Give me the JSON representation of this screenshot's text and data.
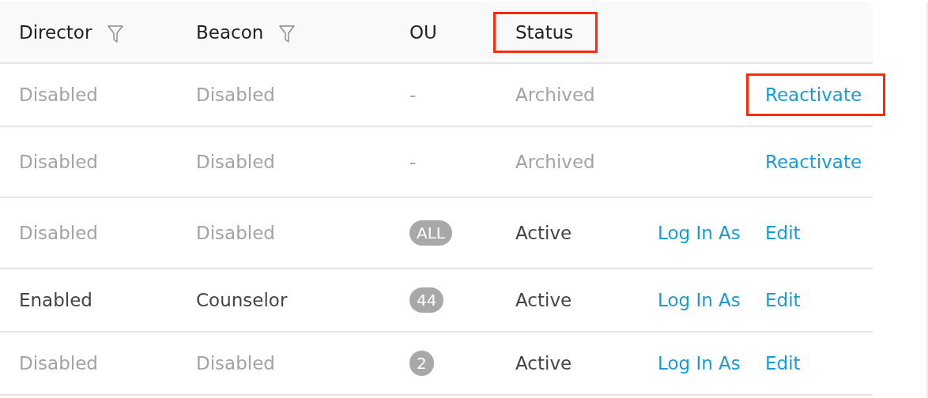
{
  "table": {
    "columns": [
      {
        "label": "Director",
        "filter": true,
        "highlighted": false
      },
      {
        "label": "Beacon",
        "filter": true,
        "highlighted": false
      },
      {
        "label": "OU",
        "filter": false,
        "highlighted": false
      },
      {
        "label": "Status",
        "filter": false,
        "highlighted": true
      }
    ],
    "rows": [
      {
        "director": {
          "text": "Disabled",
          "dimmed": true
        },
        "beacon": {
          "text": "Disabled",
          "dimmed": true
        },
        "ou": {
          "kind": "text",
          "text": "-"
        },
        "status": {
          "text": "Archived",
          "dimmed": true
        },
        "action_right": {
          "label": "Reactivate",
          "highlighted": true
        }
      },
      {
        "director": {
          "text": "Disabled",
          "dimmed": true
        },
        "beacon": {
          "text": "Disabled",
          "dimmed": true
        },
        "ou": {
          "kind": "text",
          "text": "-"
        },
        "status": {
          "text": "Archived",
          "dimmed": true
        },
        "action_right": {
          "label": "Reactivate",
          "highlighted": false
        }
      },
      {
        "director": {
          "text": "Disabled",
          "dimmed": true
        },
        "beacon": {
          "text": "Disabled",
          "dimmed": true
        },
        "ou": {
          "kind": "badge",
          "text": "ALL"
        },
        "status": {
          "text": "Active",
          "dimmed": false
        },
        "action_left": {
          "label": "Log In As",
          "highlighted": false
        },
        "action_right": {
          "label": "Edit",
          "highlighted": false
        }
      },
      {
        "director": {
          "text": "Enabled",
          "dimmed": false
        },
        "beacon": {
          "text": "Counselor",
          "dimmed": false
        },
        "ou": {
          "kind": "badge",
          "text": "44"
        },
        "status": {
          "text": "Active",
          "dimmed": false
        },
        "action_left": {
          "label": "Log In As",
          "highlighted": false
        },
        "action_right": {
          "label": "Edit",
          "highlighted": false
        }
      },
      {
        "director": {
          "text": "Disabled",
          "dimmed": true
        },
        "beacon": {
          "text": "Disabled",
          "dimmed": true
        },
        "ou": {
          "kind": "badge",
          "text": "2"
        },
        "status": {
          "text": "Active",
          "dimmed": false
        },
        "action_left": {
          "label": "Log In As",
          "highlighted": false
        },
        "action_right": {
          "label": "Edit",
          "highlighted": false
        }
      }
    ]
  }
}
